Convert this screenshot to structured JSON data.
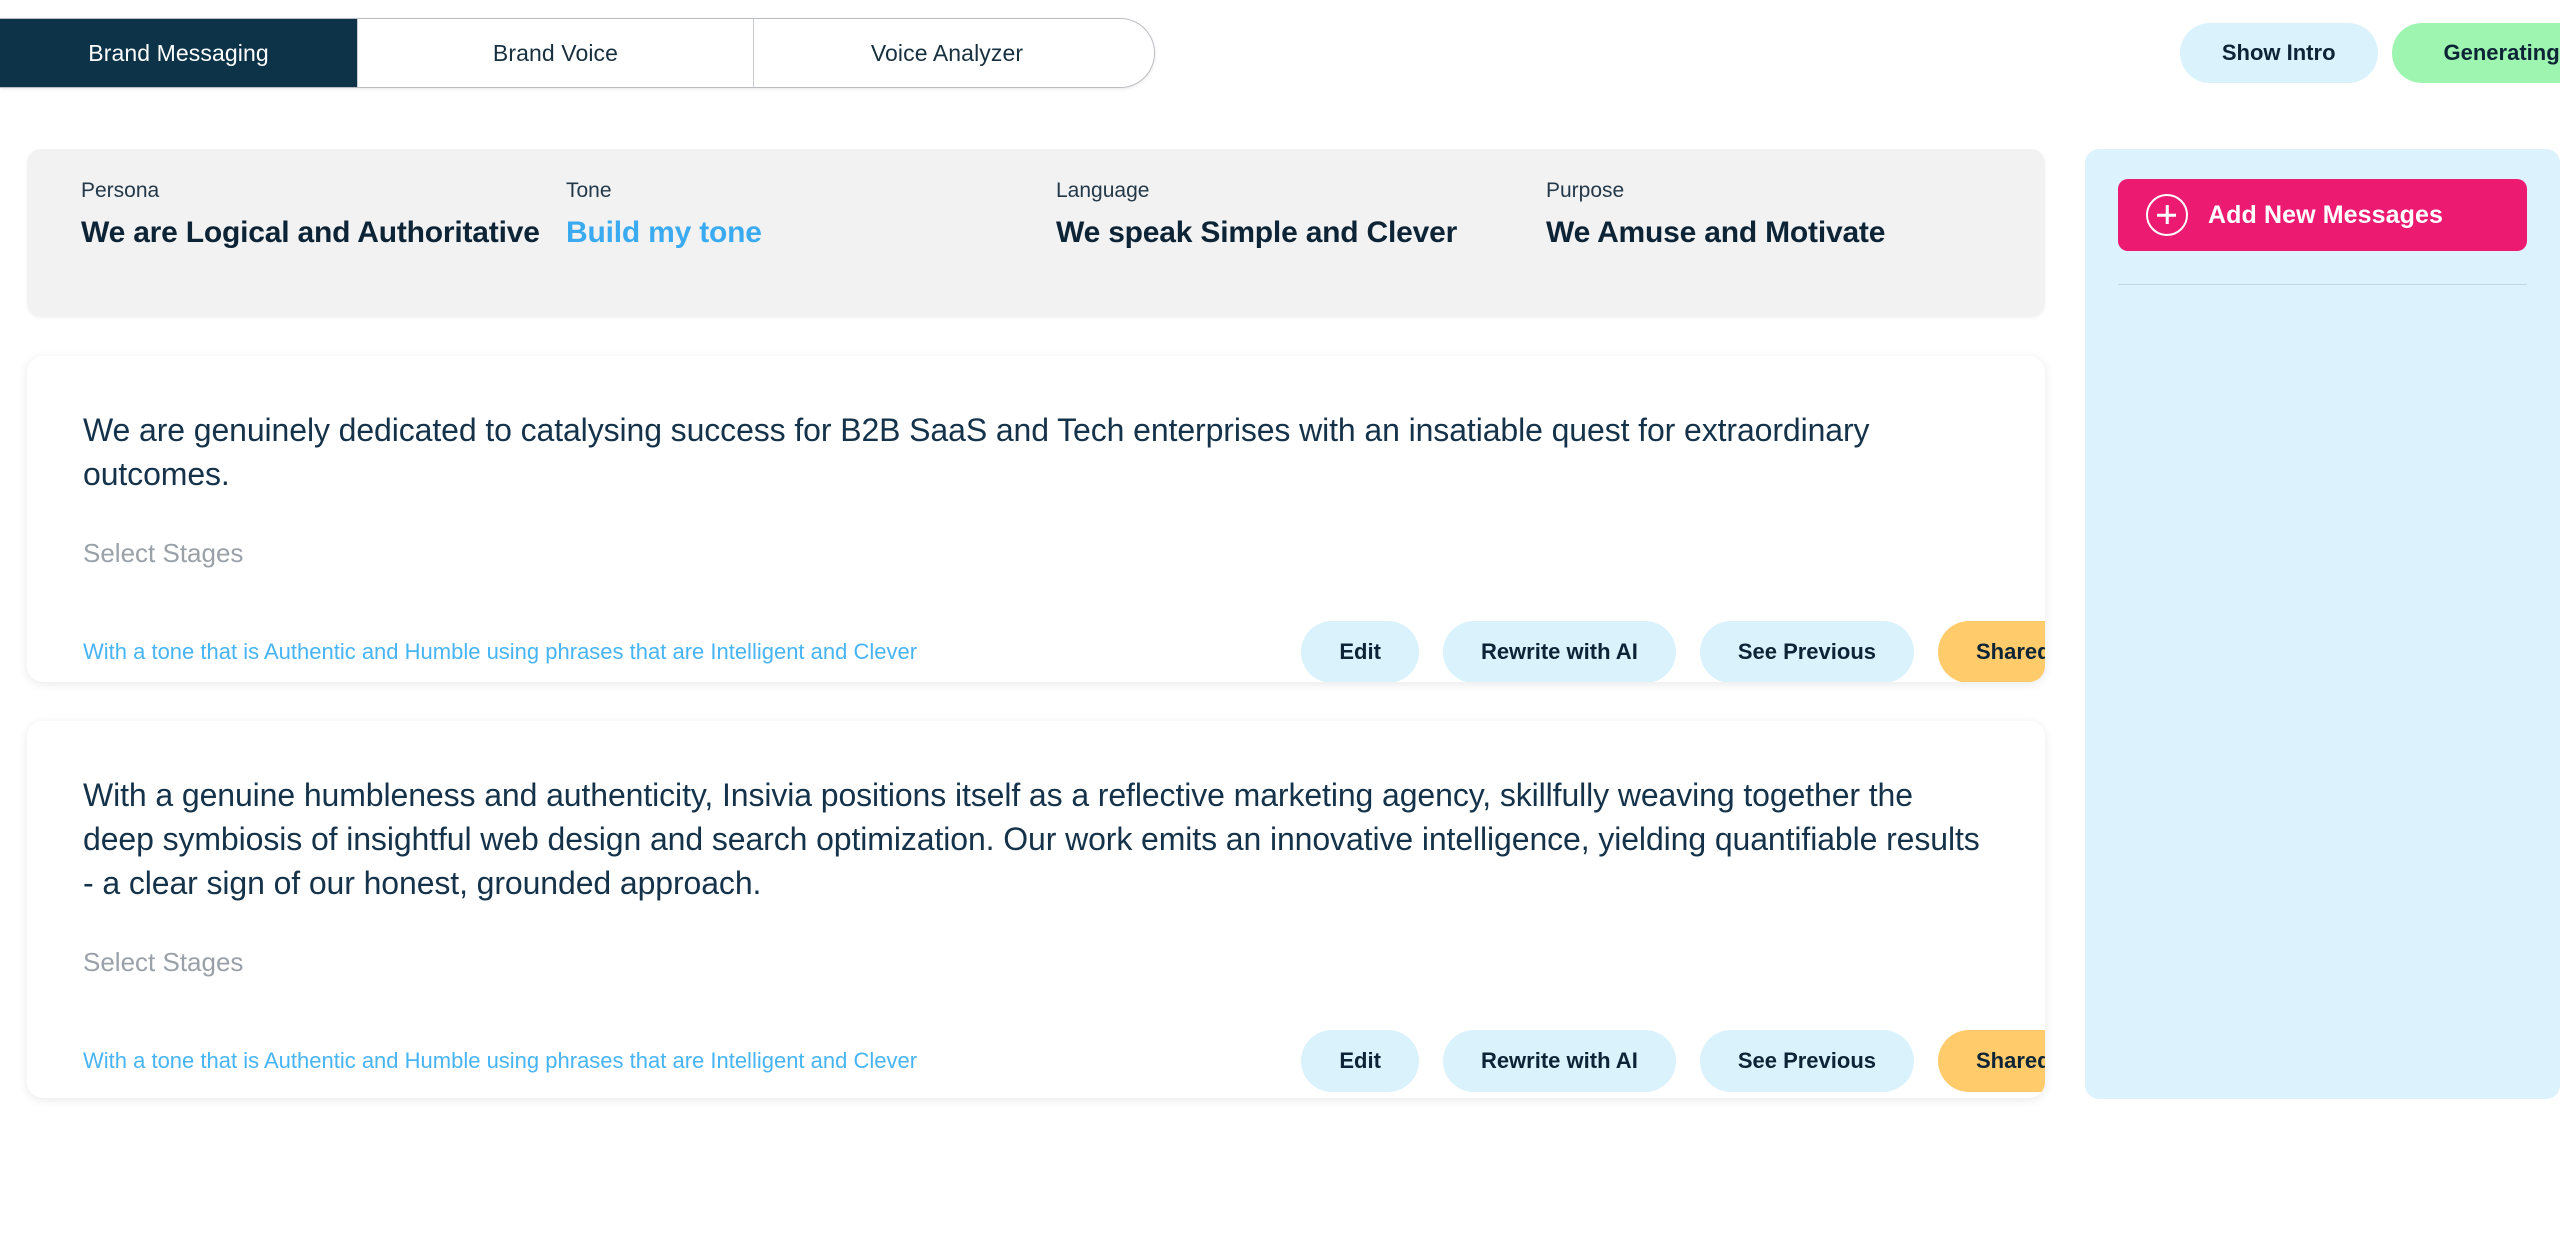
{
  "tabs": [
    {
      "label": "Brand Messaging",
      "active": true
    },
    {
      "label": "Brand Voice",
      "active": false
    },
    {
      "label": "Voice Analyzer",
      "active": false
    }
  ],
  "header": {
    "show_intro_label": "Show Intro",
    "generating_label": "Generating...",
    "intro_color": "#d9f2fc",
    "generating_color": "#9df5b0"
  },
  "attributes": [
    {
      "label": "Persona",
      "value": "We are Logical and Authoritative",
      "is_link": false
    },
    {
      "label": "Tone",
      "value": "Build my tone",
      "is_link": true
    },
    {
      "label": "Language",
      "value": "We speak Simple and Clever",
      "is_link": false
    },
    {
      "label": "Purpose",
      "value": "We Amuse and Motivate",
      "is_link": false
    }
  ],
  "messages": [
    {
      "text": "We are genuinely dedicated to catalysing success for B2B SaaS and Tech enterprises with an insatiable quest for extraordinary outcomes.",
      "stages_placeholder": "Select Stages",
      "tone_line": "With a tone that is Authentic and Humble using phrases that are Intelligent and Clever",
      "actions": {
        "edit": "Edit",
        "rewrite": "Rewrite with AI",
        "see_previous": "See Previous",
        "shared": "Shared"
      }
    },
    {
      "text": "With a genuine humbleness and authenticity, Insivia positions itself as a reflective marketing agency, skillfully weaving together the deep symbiosis of insightful web design and search optimization. Our work emits an innovative intelligence, yielding quantifiable results - a clear sign of our honest, grounded approach.",
      "stages_placeholder": "Select Stages",
      "tone_line": "With a tone that is Authentic and Humble using phrases that are Intelligent and Clever",
      "actions": {
        "edit": "Edit",
        "rewrite": "Rewrite with AI",
        "see_previous": "See Previous",
        "shared": "Shared"
      }
    }
  ],
  "sidebar": {
    "add_button_label": "Add New Messages",
    "add_button_color": "#ed1a72",
    "panel_color": "#dcf2fc",
    "plus_icon": "plus-circle-icon"
  },
  "theme": {
    "active_tab_bg": "#0d3349",
    "accent_blue": "#3aabf0",
    "shared_yellow": "#ffcb6b",
    "text_dark": "#143249"
  }
}
